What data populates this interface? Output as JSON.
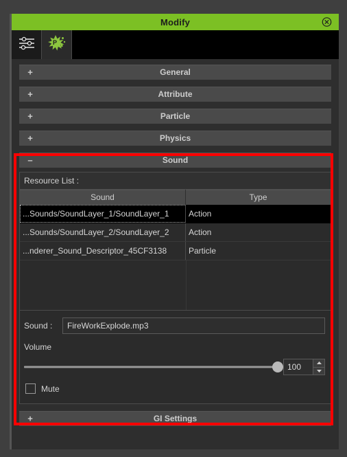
{
  "window": {
    "title": "Modify",
    "close_icon": "close-circle-icon"
  },
  "tabs": [
    {
      "id": "attributes",
      "icon": "sliders-icon",
      "active": false
    },
    {
      "id": "particle-effect",
      "icon": "particle-burst-icon",
      "active": true
    }
  ],
  "sections": [
    {
      "id": "general",
      "label": "General",
      "expanded": false,
      "sign": "+"
    },
    {
      "id": "attribute",
      "label": "Attribute",
      "expanded": false,
      "sign": "+"
    },
    {
      "id": "particle",
      "label": "Particle",
      "expanded": false,
      "sign": "+"
    },
    {
      "id": "physics",
      "label": "Physics",
      "expanded": false,
      "sign": "+"
    },
    {
      "id": "sound",
      "label": "Sound",
      "expanded": true,
      "sign": "–"
    },
    {
      "id": "gi-settings",
      "label": "GI Settings",
      "expanded": false,
      "sign": "+"
    }
  ],
  "sound_panel": {
    "resource_list_label": "Resource List :",
    "table": {
      "columns": [
        "Sound",
        "Type"
      ],
      "rows": [
        {
          "sound": "...Sounds/SoundLayer_1/SoundLayer_1",
          "type": "Action",
          "selected": true
        },
        {
          "sound": "...Sounds/SoundLayer_2/SoundLayer_2",
          "type": "Action",
          "selected": false
        },
        {
          "sound": "...nderer_Sound_Descriptor_45CF3138",
          "type": "Particle",
          "selected": false
        }
      ]
    },
    "sound_field": {
      "label": "Sound :",
      "value": "FireWorkExplode.mp3",
      "placeholder": ""
    },
    "volume": {
      "label": "Volume",
      "value": "100",
      "min": 0,
      "max": 100,
      "percent": 100
    },
    "mute": {
      "label": "Mute",
      "checked": false
    }
  },
  "colors": {
    "title_bar_green": "#7cc024",
    "panel_background": "#2e2e2e",
    "section_header": "#4a4a4a",
    "selected_row": "#000000",
    "annotation_red": "#ff0000"
  }
}
